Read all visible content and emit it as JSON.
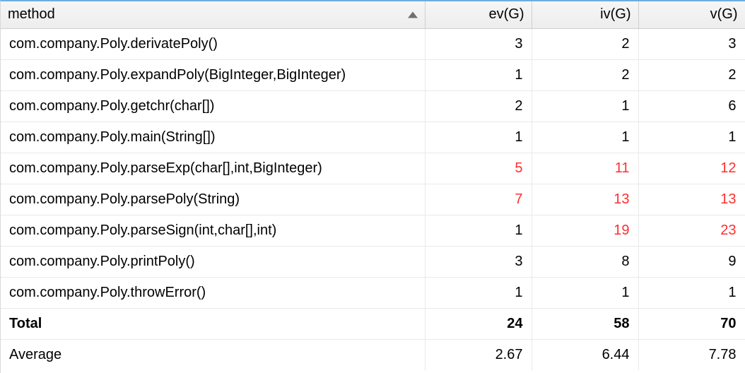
{
  "chart_data": {
    "type": "table",
    "title": "",
    "columns": [
      "method",
      "ev(G)",
      "iv(G)",
      "v(G)"
    ],
    "sort": {
      "column": "method",
      "direction": "asc"
    },
    "rows": [
      {
        "method": "com.company.Poly.derivatePoly()",
        "ev": 3,
        "iv": 2,
        "v": 3
      },
      {
        "method": "com.company.Poly.expandPoly(BigInteger,BigInteger)",
        "ev": 1,
        "iv": 2,
        "v": 2
      },
      {
        "method": "com.company.Poly.getchr(char[])",
        "ev": 2,
        "iv": 1,
        "v": 6
      },
      {
        "method": "com.company.Poly.main(String[])",
        "ev": 1,
        "iv": 1,
        "v": 1
      },
      {
        "method": "com.company.Poly.parseExp(char[],int,BigInteger)",
        "ev": 5,
        "iv": 11,
        "v": 12,
        "flags": [
          "ev",
          "iv",
          "v"
        ]
      },
      {
        "method": "com.company.Poly.parsePoly(String)",
        "ev": 7,
        "iv": 13,
        "v": 13,
        "flags": [
          "ev",
          "iv",
          "v"
        ]
      },
      {
        "method": "com.company.Poly.parseSign(int,char[],int)",
        "ev": 1,
        "iv": 19,
        "v": 23,
        "flags": [
          "iv",
          "v"
        ]
      },
      {
        "method": "com.company.Poly.printPoly()",
        "ev": 3,
        "iv": 8,
        "v": 9
      },
      {
        "method": "com.company.Poly.throwError()",
        "ev": 1,
        "iv": 1,
        "v": 1
      }
    ],
    "summary": [
      {
        "label": "Total",
        "ev": 24,
        "iv": 58,
        "v": 70,
        "bold": true
      },
      {
        "label": "Average",
        "ev": 2.67,
        "iv": 6.44,
        "v": 7.78
      }
    ]
  }
}
